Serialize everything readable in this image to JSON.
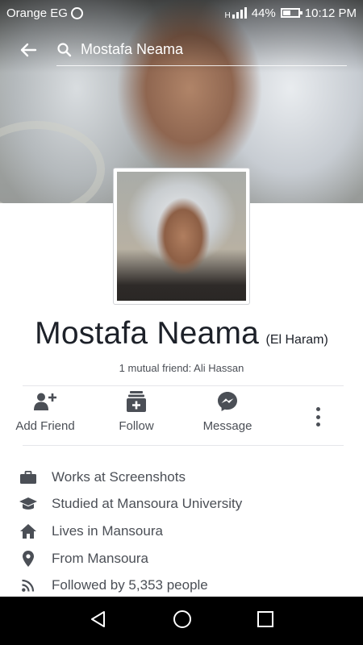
{
  "status_bar": {
    "carrier": "Orange EG",
    "network": "H",
    "battery": "44%",
    "time": "10:12 PM"
  },
  "search": {
    "query": "Mostafa Neama"
  },
  "profile": {
    "name": "Mostafa Neama",
    "alternate_name": "(El Haram)",
    "mutual_friends": "1 mutual friend: Ali Hassan"
  },
  "actions": [
    {
      "label": "Add Friend",
      "icon": "add-friend-icon"
    },
    {
      "label": "Follow",
      "icon": "follow-icon"
    },
    {
      "label": "Message",
      "icon": "messenger-icon"
    }
  ],
  "intro": [
    {
      "icon": "briefcase-icon",
      "text": "Works at Screenshots"
    },
    {
      "icon": "graduation-cap-icon",
      "text": "Studied at Mansoura University"
    },
    {
      "icon": "home-icon",
      "text": "Lives in Mansoura"
    },
    {
      "icon": "location-pin-icon",
      "text": "From Mansoura"
    },
    {
      "icon": "rss-icon",
      "text": "Followed by 5,353 people"
    }
  ],
  "colors": {
    "icon_gray": "#4b4f56",
    "text_dark": "#1d2129",
    "divider": "#e5e6ea",
    "nav_bar": "#000000"
  }
}
